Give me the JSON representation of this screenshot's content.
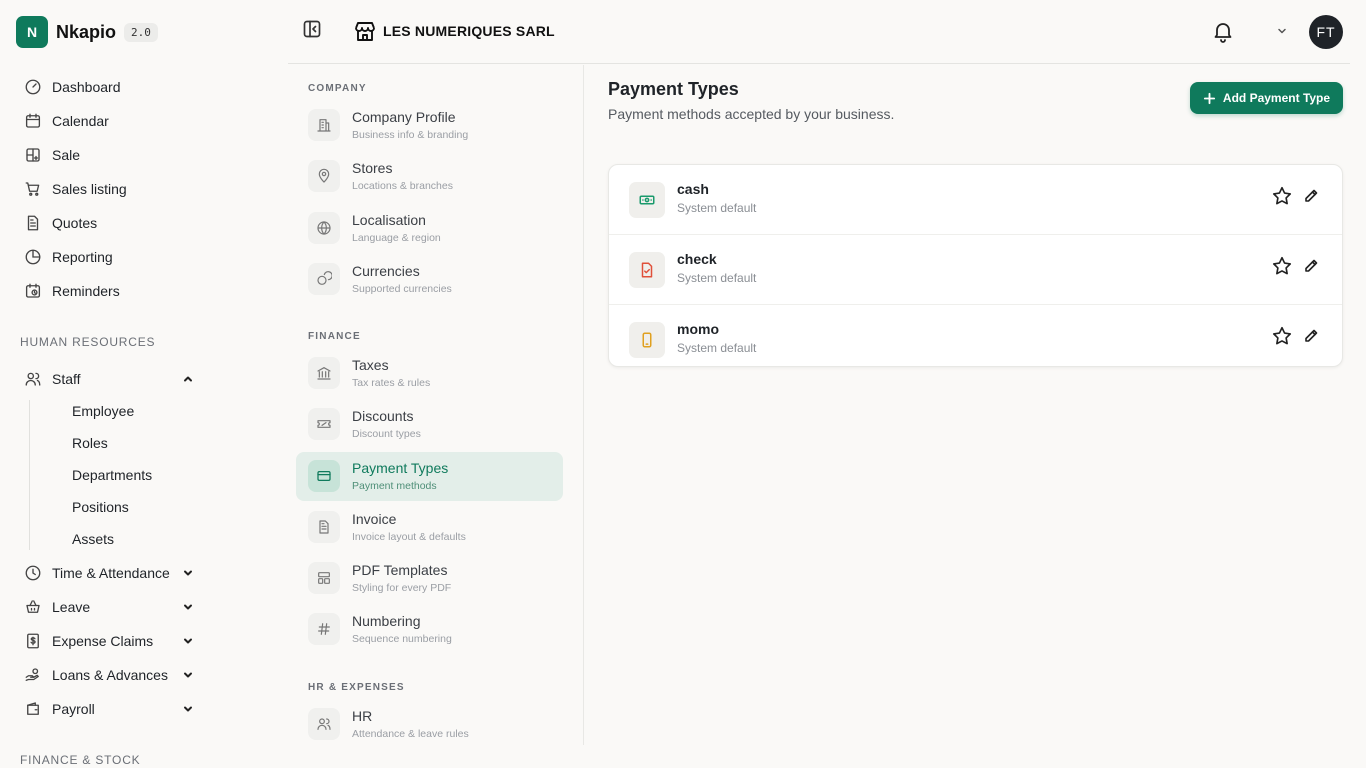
{
  "brand": {
    "logo_letter": "N",
    "name": "Nkapio",
    "version": "2.0"
  },
  "sidebar": {
    "main_items": [
      {
        "label": "Dashboard",
        "icon": "dashboard-icon"
      },
      {
        "label": "Calendar",
        "icon": "calendar-icon"
      },
      {
        "label": "Sale",
        "icon": "sale-grid-icon"
      },
      {
        "label": "Sales listing",
        "icon": "cart-icon"
      },
      {
        "label": "Quotes",
        "icon": "document-icon"
      },
      {
        "label": "Reporting",
        "icon": "pie-chart-icon"
      },
      {
        "label": "Reminders",
        "icon": "calendar-clock-icon"
      }
    ],
    "hr_title": "HUMAN RESOURCES",
    "staff": {
      "label": "Staff",
      "expanded": true,
      "children": [
        "Employee",
        "Roles",
        "Departments",
        "Positions",
        "Assets"
      ]
    },
    "hr_items": [
      {
        "label": "Time & Attendance",
        "icon": "clock-icon"
      },
      {
        "label": "Leave",
        "icon": "leave-basket-icon"
      },
      {
        "label": "Expense Claims",
        "icon": "receipt-icon"
      },
      {
        "label": "Loans & Advances",
        "icon": "hand-coins-icon"
      },
      {
        "label": "Payroll",
        "icon": "wallet-icon"
      }
    ],
    "finance_title": "FINANCE & STOCK"
  },
  "topbar": {
    "store_name": "LES NUMERIQUES SARL",
    "avatar_initials": "FT"
  },
  "settings_nav": {
    "company_title": "COMPANY",
    "company": [
      {
        "title": "Company Profile",
        "subtitle": "Business info & branding",
        "icon": "building-icon"
      },
      {
        "title": "Stores",
        "subtitle": "Locations & branches",
        "icon": "map-pin-icon"
      },
      {
        "title": "Localisation",
        "subtitle": "Language & region",
        "icon": "globe-icon"
      },
      {
        "title": "Currencies",
        "subtitle": "Supported currencies",
        "icon": "coins-icon"
      }
    ],
    "finance_title": "FINANCE",
    "finance": [
      {
        "title": "Taxes",
        "subtitle": "Tax rates & rules",
        "icon": "bank-icon"
      },
      {
        "title": "Discounts",
        "subtitle": "Discount types",
        "icon": "ticket-icon"
      },
      {
        "title": "Payment Types",
        "subtitle": "Payment methods",
        "icon": "credit-card-icon",
        "active": true
      },
      {
        "title": "Invoice",
        "subtitle": "Invoice layout & defaults",
        "icon": "invoice-icon"
      },
      {
        "title": "PDF Templates",
        "subtitle": "Styling for every PDF",
        "icon": "template-icon"
      },
      {
        "title": "Numbering",
        "subtitle": "Sequence numbering",
        "icon": "hash-icon"
      }
    ],
    "hr_title": "HR & EXPENSES",
    "hr": [
      {
        "title": "HR",
        "subtitle": "Attendance & leave rules",
        "icon": "users-icon"
      }
    ]
  },
  "main": {
    "title": "Payment Types",
    "subtitle": "Payment methods accepted by your business.",
    "add_button_label": "Add Payment Type",
    "payment_types": [
      {
        "name": "cash",
        "meta": "System default",
        "icon": "banknote-icon",
        "color": "#1a9a6c"
      },
      {
        "name": "check",
        "meta": "System default",
        "icon": "check-document-icon",
        "color": "#e0503a"
      },
      {
        "name": "momo",
        "meta": "System default",
        "icon": "smartphone-icon",
        "color": "#e0a020"
      }
    ]
  },
  "colors": {
    "accent": "#0f7a5c",
    "active_bg": "#e3eee9"
  }
}
